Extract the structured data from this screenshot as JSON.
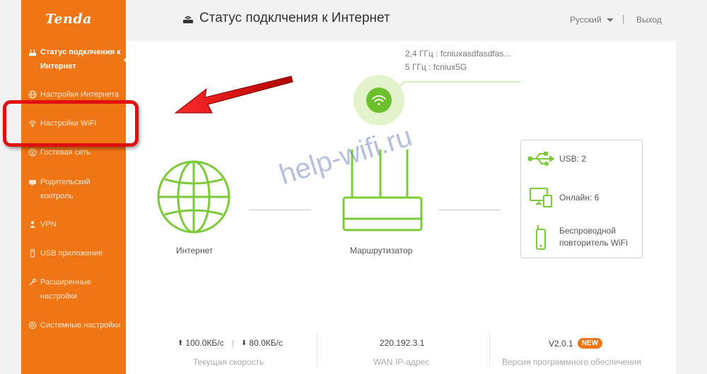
{
  "brand": {
    "logo": "Tenda"
  },
  "sidebar": {
    "items": [
      {
        "label": "Статус подклчения к Интернет",
        "icon": "router-icon",
        "active": true
      },
      {
        "label": "Настройки Интернета",
        "icon": "globe-icon"
      },
      {
        "label": "Настройки WiFi",
        "icon": "wifi-icon"
      },
      {
        "label": "Гостевая сеть",
        "icon": "guest-network-icon"
      },
      {
        "label": "Родительский контроль",
        "icon": "parental-control-icon"
      },
      {
        "label": "VPN",
        "icon": "vpn-icon"
      },
      {
        "label": "USB приложение",
        "icon": "usb-icon"
      },
      {
        "label": "Расширенные настройки",
        "icon": "wrench-icon"
      },
      {
        "label": "Системные настройки",
        "icon": "gear-icon"
      }
    ]
  },
  "header": {
    "title": "Статус подклчения к Интернет",
    "language": "Русский",
    "separator": "|",
    "logout": "Выход"
  },
  "main": {
    "wifi": {
      "ssid_24": "2,4 ГГц : fcniuxasdfasdfas...",
      "ssid_5": "5 ГГц : fcniux5G"
    },
    "internet_label": "Интернет",
    "router_label": "Маршрутизатор",
    "devices": {
      "usb": "USB:  2",
      "online": "Онлайн:  6",
      "repeater": "Беспроводной повторитель WiFi"
    },
    "stats": {
      "upload": "100.0КБ/с",
      "download": "80.0КБ/с",
      "speed_label": "Текущая скорость",
      "wan_ip": "220.192.3.1",
      "wan_label": "WAN IP-адрес",
      "firmware": "V2.0.1",
      "firmware_badge": "NEW",
      "firmware_label": "Версия программного обеспечения"
    }
  },
  "watermark": "help-wifi.ru",
  "colors": {
    "accent": "#f07514",
    "green": "#6cc02b",
    "annotation": "#e01010"
  }
}
